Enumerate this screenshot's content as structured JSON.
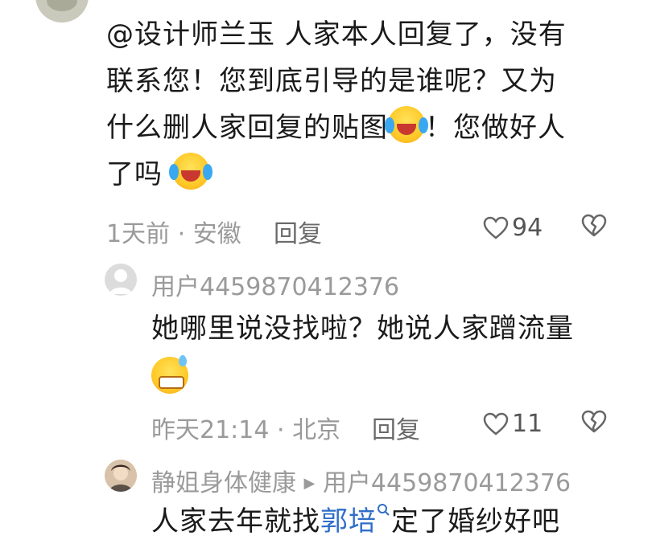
{
  "comment": {
    "lines": [
      "@设计师兰玉  人家本人回复了，没有",
      "联系您！您到底引导的是谁呢？又为",
      "什么删人家回复的贴图",
      "！您做好人",
      "了吗"
    ],
    "time_location": "1天前 · 安徽",
    "reply_label": "回复",
    "like_count": "94"
  },
  "reply1": {
    "username": "用户4459870412376",
    "text": "她哪里说没找啦？她说人家蹭流量",
    "time_location": "昨天21:14 · 北京",
    "reply_label": "回复",
    "like_count": "11"
  },
  "reply2": {
    "username": "静姐身体健康",
    "reply_to": "用户4459870412376",
    "text_before": "人家去年就找",
    "link_text": "郭培",
    "text_after": "定了婚纱好吧"
  },
  "colors": {
    "meta": "#9a9a9a",
    "link": "#2f6ec8",
    "text": "#1a1a1a"
  }
}
